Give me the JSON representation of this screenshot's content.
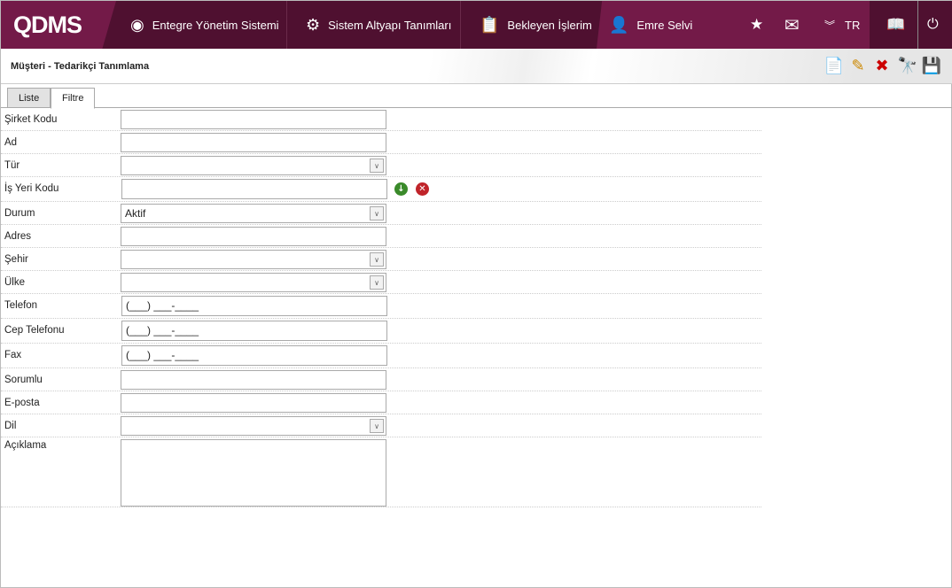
{
  "header": {
    "logo": "QDMS",
    "nav": [
      {
        "label": "Entegre Yönetim Sistemi",
        "icon": "q-icon"
      },
      {
        "label": "Sistem Altyapı Tanımları",
        "icon": "gear-icon"
      },
      {
        "label": "Bekleyen İşlerim",
        "icon": "clipboard-icon"
      }
    ],
    "user": "Emre Selvi",
    "language": "TR"
  },
  "page": {
    "title": "Müşteri - Tedarikçi Tanımlama",
    "tabs": [
      "Liste",
      "Filtre"
    ],
    "active_tab": "Filtre"
  },
  "form": {
    "fields": [
      {
        "label": "Şirket Kodu",
        "type": "text",
        "value": ""
      },
      {
        "label": "Ad",
        "type": "text",
        "value": ""
      },
      {
        "label": "Tür",
        "type": "select",
        "value": ""
      },
      {
        "label": "İş Yeri Kodu",
        "type": "lookup",
        "value": ""
      },
      {
        "label": "Durum",
        "type": "select",
        "value": "Aktif"
      },
      {
        "label": "Adres",
        "type": "text",
        "value": ""
      },
      {
        "label": "Şehir",
        "type": "select",
        "value": ""
      },
      {
        "label": "Ülke",
        "type": "select",
        "value": ""
      },
      {
        "label": "Telefon",
        "type": "phone",
        "value": "(___) ___-____"
      },
      {
        "label": "Cep Telefonu",
        "type": "phone",
        "value": "(___) ___-____"
      },
      {
        "label": "Fax",
        "type": "phone",
        "value": "(___) ___-____"
      },
      {
        "label": "Sorumlu",
        "type": "text",
        "value": ""
      },
      {
        "label": "E-posta",
        "type": "text",
        "value": ""
      },
      {
        "label": "Dil",
        "type": "select",
        "value": ""
      },
      {
        "label": "Açıklama",
        "type": "textarea",
        "value": ""
      }
    ]
  }
}
